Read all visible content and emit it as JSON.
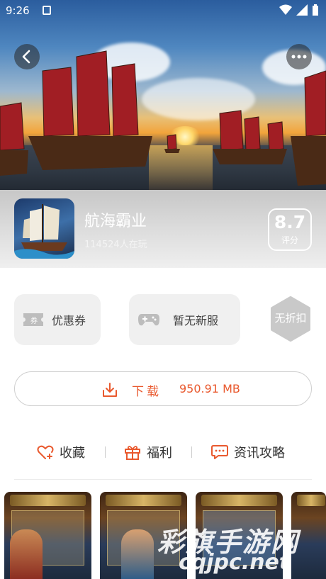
{
  "status_bar": {
    "time": "9:26"
  },
  "app": {
    "title": "航海霸业",
    "players": "114524人在玩",
    "score": "8.7",
    "score_label": "评分"
  },
  "tags": {
    "coupon": "优惠券",
    "server": "暂无新服",
    "discount": "无折扣"
  },
  "download": {
    "label": "下载",
    "size": "950.91 MB"
  },
  "actions": {
    "favorite": "收藏",
    "welfare": "福利",
    "news": "资讯攻略"
  },
  "watermark": {
    "line1": "彩旗手游网",
    "line2": "cqjpc.net"
  },
  "colors": {
    "accent": "#e9592e",
    "tag_bg": "#f0f0f0",
    "hex_bg": "#c9c9c9"
  }
}
